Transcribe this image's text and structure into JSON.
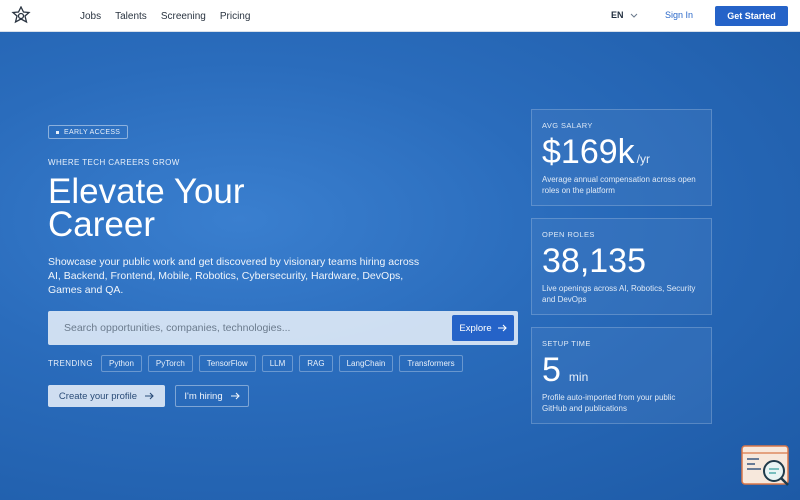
{
  "header": {
    "nav": [
      "Jobs",
      "Talents",
      "Screening",
      "Pricing"
    ],
    "language": "EN",
    "sign_in": "Sign In",
    "get_started": "Get Started"
  },
  "hero": {
    "badge": "EARLY ACCESS",
    "eyebrow": "WHERE TECH CAREERS GROW",
    "headline_line1": "Elevate Your",
    "headline_line2": "Career",
    "description": "Showcase your public work and get discovered by visionary teams hiring across AI, Backend, Frontend, Mobile, Robotics, Cybersecurity, Hardware, DevOps, Games and QA.",
    "search_placeholder": "Search opportunities, companies, technologies...",
    "explore": "Explore",
    "trending_label": "TRENDING",
    "trending": [
      "Python",
      "PyTorch",
      "TensorFlow",
      "LLM",
      "RAG",
      "LangChain",
      "Transformers"
    ],
    "cta_primary": "Create your profile",
    "cta_secondary": "I'm hiring"
  },
  "stats": [
    {
      "label": "AVG SALARY",
      "value": "$169k",
      "unit": "/yr",
      "note": "Average annual compensation across open roles on the platform"
    },
    {
      "label": "OPEN ROLES",
      "value": "38,135",
      "unit": "",
      "note": "Live openings across AI, Robotics, Security and DevOps"
    },
    {
      "label": "SETUP TIME",
      "value": "5",
      "unit": "min",
      "note": "Profile auto-imported from your public GitHub and publications"
    }
  ],
  "colors": {
    "accent": "#2563c8",
    "hero": "#2a6cbc"
  }
}
